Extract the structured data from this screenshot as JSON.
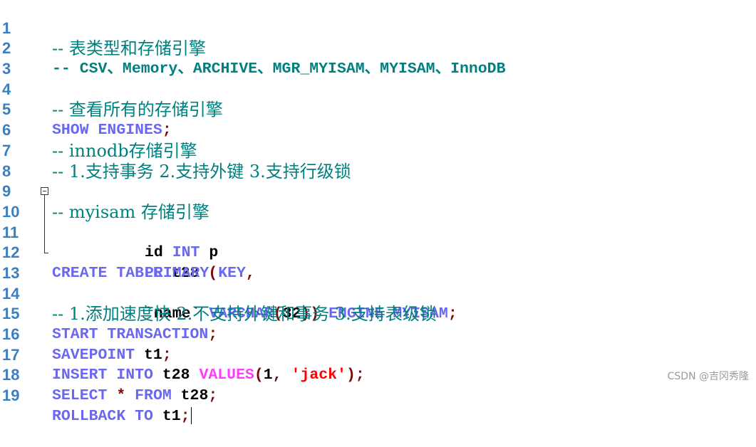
{
  "editor": {
    "lines": [
      {
        "num": "1",
        "comment": "-- 表类型和存储引擎"
      },
      {
        "num": "2",
        "comment": "-- CSV、Memory、ARCHIVE、MGR_MYISAM、MYISAM、InnoDB"
      },
      {
        "num": "3"
      },
      {
        "num": "4",
        "comment": "-- 查看所有的存储引擎"
      },
      {
        "num": "5",
        "kw": "SHOW ENGINES",
        "punct": ";"
      },
      {
        "num": "6",
        "comment": "-- innodb存储引擎"
      },
      {
        "num": "7",
        "comment": "-- 1.支持事务 2.支持外键 3.支持行级锁"
      },
      {
        "num": "8"
      },
      {
        "num": "9",
        "comment": "-- myisam 存储引擎"
      },
      {
        "num": "10",
        "kw": "CREATE TABLE",
        "ident": "t28",
        "punct": "("
      },
      {
        "num": "11",
        "ident": "id",
        "kw": "INT",
        "ident2": "p"
      },
      {
        "num": "12",
        "kw": "PRIMARY KEY",
        "punct": ","
      },
      {
        "num": "13",
        "ident": "`name`",
        "kw": "VARCHAR",
        "open": "(",
        "value": "32",
        "close": "))",
        "kw2": "ENGINE MYISAM",
        "punct": ";"
      },
      {
        "num": "14",
        "comment": "-- 1.添加速度快 2.不支持外键和事务 3.支持表级锁"
      },
      {
        "num": "15",
        "kw": "START TRANSACTION",
        "punct": ";"
      },
      {
        "num": "16",
        "kw": "SAVEPOINT",
        "ident": "t1",
        "punct": ";"
      },
      {
        "num": "17",
        "kw": "INSERT INTO",
        "ident": "t28",
        "fn": "VALUES",
        "open": "(",
        "value": "1",
        "comma": ",",
        "string": "'jack'",
        "close": ")",
        "punct": ";"
      },
      {
        "num": "18",
        "kw": "SELECT",
        "star": "*",
        "kw2": "FROM",
        "ident": "t28",
        "punct": ";"
      },
      {
        "num": "19",
        "kw": "ROLLBACK TO",
        "ident": "t1",
        "punct": ";"
      }
    ]
  },
  "colors": {
    "line_number": "#3c7fc0",
    "comment": "#00807f",
    "keyword": "#6a67f2",
    "identifier": "#000000",
    "operator": "#7a0a0a",
    "function": "#ff3cff",
    "string": "#ff0000"
  },
  "watermark": "CSDN @吉冈秀隆"
}
